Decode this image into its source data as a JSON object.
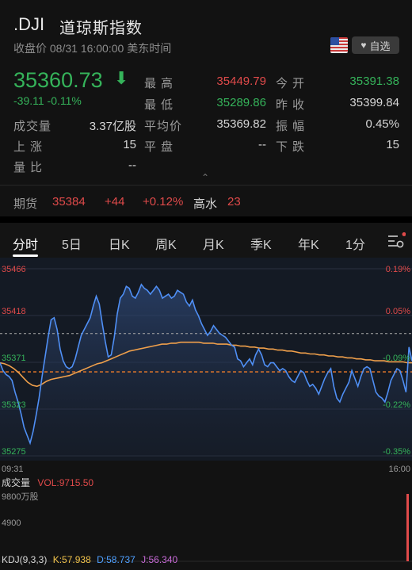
{
  "header": {
    "code": ".DJI",
    "name": "道琼斯指数",
    "subtitle": "收盘价 08/31 16:00:00 美东时间",
    "favorite_label": "自选"
  },
  "quote": {
    "price": "35360.73",
    "change": "-39.11 -0.11%",
    "rows": [
      [
        {
          "label": "最高",
          "value": "35449.79",
          "color": "red"
        },
        {
          "label": "今开",
          "value": "35391.38",
          "color": "green"
        }
      ],
      [
        {
          "label": "最低",
          "value": "35289.86",
          "color": "green"
        },
        {
          "label": "昨收",
          "value": "35399.84",
          "color": "white"
        }
      ]
    ],
    "stats": [
      {
        "label": "成交量",
        "value": "3.37亿股"
      },
      {
        "label": "平均价",
        "value": "35369.82"
      },
      {
        "label": "振幅",
        "value": "0.45%"
      },
      {
        "label": "上涨",
        "value": "15"
      },
      {
        "label": "平盘",
        "value": "--"
      },
      {
        "label": "下跌",
        "value": "15"
      },
      {
        "label": "量比",
        "value": "--"
      }
    ],
    "expand_glyph": "⌃"
  },
  "futures": {
    "label": "期货",
    "price": "35384",
    "change": "+44",
    "change_pct": "+0.12%",
    "premium_label": "高水",
    "premium": "23"
  },
  "tabs": [
    "分时",
    "5日",
    "日K",
    "周K",
    "月K",
    "季K",
    "年K",
    "1分"
  ],
  "active_tab": "分时",
  "chart_data": {
    "type": "line",
    "y_ticks": [
      "35466",
      "35418",
      "35371",
      "35323",
      "35275"
    ],
    "pct_ticks": [
      "0.19%",
      "0.05%",
      "-0.09%",
      "-0.22%",
      "-0.35%"
    ],
    "x_start": "09:31",
    "x_end": "16:00",
    "ylim": [
      35275,
      35466
    ],
    "prev_close": 35399.84,
    "price_color": "#4f8ff5",
    "avg_color": "#f0a04b",
    "series": [
      {
        "values": [
          35370,
          35362,
          35358,
          35356,
          35352,
          35340,
          35330,
          35318,
          35304,
          35296,
          35288,
          35300,
          35316,
          35334,
          35356,
          35376,
          35396,
          35414,
          35416,
          35404,
          35384,
          35372,
          35366,
          35364,
          35366,
          35374,
          35386,
          35398,
          35404,
          35410,
          35416,
          35428,
          35438,
          35430,
          35410,
          35392,
          35376,
          35378,
          35396,
          35420,
          35436,
          35440,
          35448,
          35446,
          35438,
          35436,
          35442,
          35450,
          35446,
          35444,
          35440,
          35444,
          35448,
          35444,
          35436,
          35438,
          35440,
          35436,
          35438,
          35444,
          35442,
          35440,
          35432,
          35428,
          35434,
          35424,
          35418,
          35410,
          35404,
          35398,
          35402,
          35408,
          35404,
          35400,
          35398,
          35396,
          35392,
          35388,
          35386,
          35374,
          35372,
          35366,
          35370,
          35374,
          35368,
          35378,
          35384,
          35378,
          35368,
          35366,
          35370,
          35370,
          35366,
          35362,
          35364,
          35362,
          35356,
          35352,
          35350,
          35356,
          35362,
          35360,
          35352,
          35346,
          35348,
          35344,
          35338,
          35346,
          35354,
          35360,
          35364,
          35346,
          35334,
          35330,
          35338,
          35344,
          35350,
          35362,
          35354,
          35346,
          35356,
          35364,
          35366,
          35364,
          35352,
          35340,
          35336,
          35334,
          35330,
          35340,
          35352,
          35358,
          35364,
          35362,
          35352,
          35340,
          35386,
          35372
        ]
      },
      {
        "values": [
          35370,
          35369,
          35367,
          35364,
          35360,
          35355,
          35350,
          35347,
          35346,
          35348,
          35351,
          35353,
          35354,
          35355,
          35356,
          35357,
          35359,
          35361,
          35363,
          35365,
          35367,
          35369,
          35370,
          35372,
          35374,
          35376,
          35378,
          35380,
          35382,
          35383,
          35384,
          35385,
          35386,
          35387,
          35388,
          35389,
          35389,
          35390,
          35390,
          35391,
          35391,
          35391,
          35391,
          35391,
          35390,
          35390,
          35390,
          35389,
          35389,
          35389,
          35388,
          35388,
          35387,
          35387,
          35386,
          35386,
          35385,
          35385,
          35384,
          35384,
          35383,
          35383,
          35382,
          35382,
          35381,
          35380,
          35380,
          35379,
          35379,
          35378,
          35378,
          35377,
          35377,
          35376,
          35376,
          35375,
          35375,
          35374,
          35374,
          35373,
          35373,
          35372,
          35372,
          35372,
          35371,
          35371,
          35371,
          35371,
          35370,
          35370
        ]
      }
    ],
    "volume_title": "成交量",
    "volume_label": "VOL:9715.50",
    "volume_ticks": [
      "9800万股",
      "4900"
    ],
    "kdj": {
      "label": "KDJ(9,3,3)",
      "k": "K:57.938",
      "d": "D:58.737",
      "j": "J:56.340"
    }
  }
}
